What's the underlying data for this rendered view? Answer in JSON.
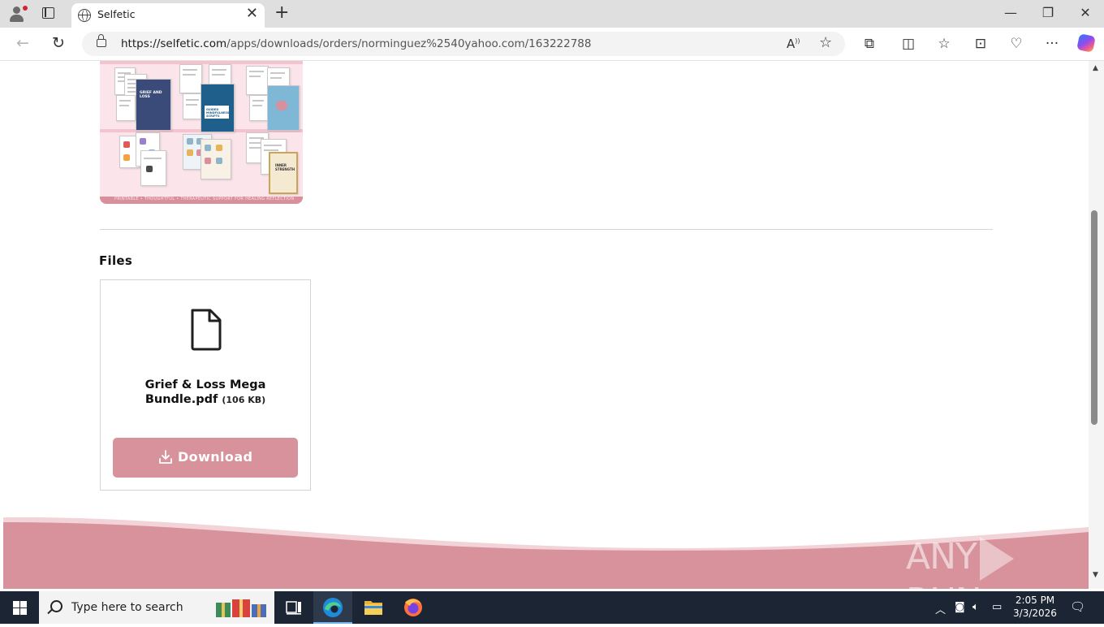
{
  "browser": {
    "tab_title": "Selfetic",
    "url_host": "https://selfetic.com",
    "url_path": "/apps/downloads/orders/norminguez%2540yahoo.com/163222788"
  },
  "product_image": {
    "cover_titles": [
      "GRIEF AND LOSS",
      "GUIDED MINDFULNESS SCRIPTS",
      "INNER STRENGTH"
    ],
    "footer_text": "PRINTABLE • THOUGHTFUL • THERAPEUTIC SUPPORT FOR HEALING REFLECTION"
  },
  "files": {
    "heading": "Files",
    "items": [
      {
        "name": "Grief & Loss Mega Bundle.pdf",
        "size": "(106 KB)",
        "download_label": "Download"
      }
    ]
  },
  "watermark": {
    "left": "ANY",
    "right": "RUN"
  },
  "taskbar": {
    "search_placeholder": "Type here to search",
    "time": "2:05 PM",
    "date": "3/3/2026"
  },
  "colors": {
    "accent": "#d8929c",
    "wave_light": "#f2d3d8",
    "taskbar": "#1c2533"
  }
}
